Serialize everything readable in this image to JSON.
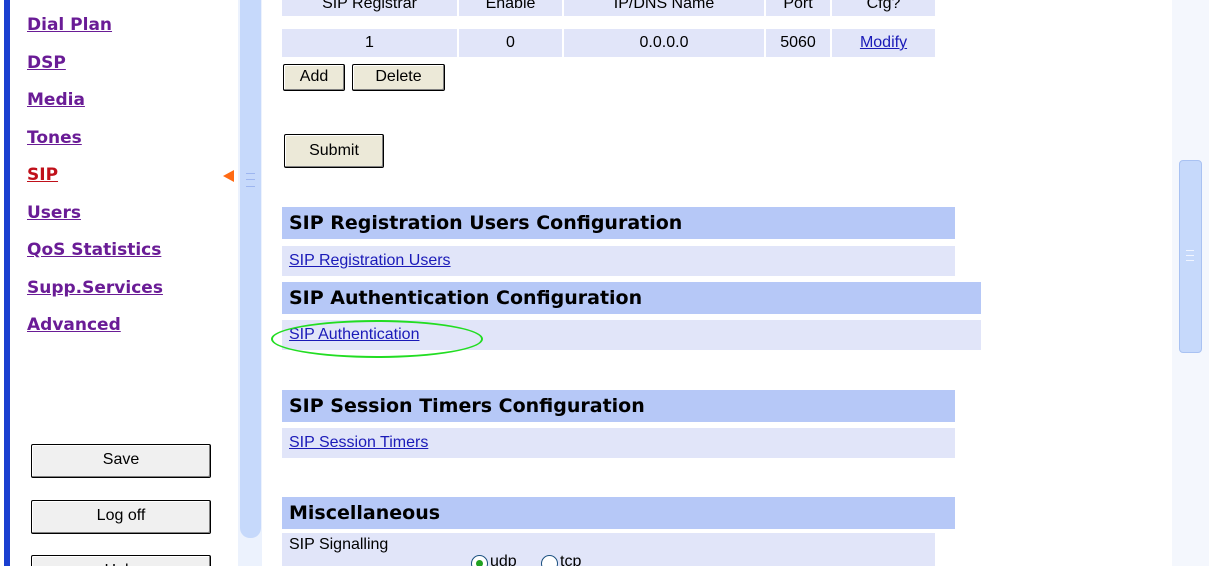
{
  "nav": {
    "items": [
      {
        "label": "Dial Plan"
      },
      {
        "label": "DSP"
      },
      {
        "label": "Media"
      },
      {
        "label": "Tones"
      },
      {
        "label": "SIP"
      },
      {
        "label": "Users"
      },
      {
        "label": "QoS Statistics"
      },
      {
        "label": "Supp.Services"
      },
      {
        "label": "Advanced"
      }
    ],
    "active": "SIP",
    "save_label": "Save",
    "logoff_label": "Log off",
    "help_label": "Help"
  },
  "registrar_table": {
    "headers": [
      "SIP Registrar",
      "Enable",
      "IP/DNS Name",
      "Port",
      "Cfg?"
    ],
    "rows": [
      {
        "index": "1",
        "enable": "0",
        "ip": "0.0.0.0",
        "port": "5060",
        "action": "Modify"
      }
    ]
  },
  "buttons": {
    "add": "Add",
    "delete": "Delete",
    "submit": "Submit"
  },
  "sections": {
    "reg_users": {
      "title": "SIP Registration Users Configuration",
      "link": "SIP Registration Users"
    },
    "auth": {
      "title": "SIP Authentication Configuration",
      "link": "SIP Authentication"
    },
    "timers": {
      "title": "SIP Session Timers Configuration",
      "link": "SIP Session Timers"
    },
    "misc": {
      "title": "Miscellaneous",
      "signalling_label": "SIP Signalling",
      "transport_options": [
        "udp",
        "tcp"
      ],
      "transport_selected": "udp"
    }
  },
  "colors": {
    "nav_link": "#6a1c96",
    "nav_active": "#c0101a",
    "section_header": "#b6c8f7",
    "row_background": "#e1e5f9",
    "highlight": "#22dd22",
    "active_marker": "#ff6a13"
  }
}
